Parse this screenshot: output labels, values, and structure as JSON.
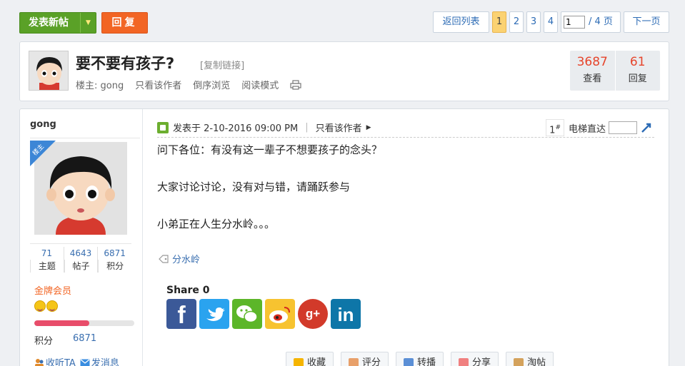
{
  "toolbar": {
    "new_post": "发表新帖",
    "reply": "回复"
  },
  "pager": {
    "back": "返回列表",
    "pages": [
      "1",
      "2",
      "3",
      "4"
    ],
    "current": "1",
    "jump_value": "1",
    "total": "/ 4 页",
    "next": "下一页"
  },
  "thread": {
    "title": "要不要有孩子?",
    "copy_link": "[复制链接]",
    "owner": "楼主: gong",
    "only_author": "只看该作者",
    "reverse": "倒序浏览",
    "read_mode": "阅读模式",
    "views": "3687",
    "views_label": "查看",
    "replies": "61",
    "replies_label": "回复"
  },
  "author": {
    "name": "gong",
    "badge": "楼主",
    "stats": [
      {
        "value": "71",
        "label": "主题"
      },
      {
        "value": "4643",
        "label": "帖子"
      },
      {
        "value": "6871",
        "label": "积分"
      }
    ],
    "rank": "金牌会员",
    "progress_fraction": 0.55,
    "score_label": "积分",
    "score_value": "6871",
    "follow": "收听TA",
    "message": "发消息"
  },
  "post": {
    "posted": "发表于 2-10-2016 09:00 PM",
    "only_author": "只看该作者",
    "floor": "1",
    "floor_sup": "#",
    "elevator": "电梯直达",
    "lines": [
      "问下各位：有没有这一辈子不想要孩子的念头？",
      "大家讨论讨论，没有对与错，请踊跃参与",
      "小弟正在人生分水岭。。。"
    ],
    "tag": "分水岭",
    "share_label": "Share 0",
    "share_icons": [
      "facebook-icon",
      "twitter-icon",
      "wechat-icon",
      "weibo-icon",
      "google-plus-icon",
      "linkedin-icon"
    ],
    "actions": [
      "收藏",
      "评分",
      "转播",
      "分享",
      "淘帖"
    ]
  }
}
